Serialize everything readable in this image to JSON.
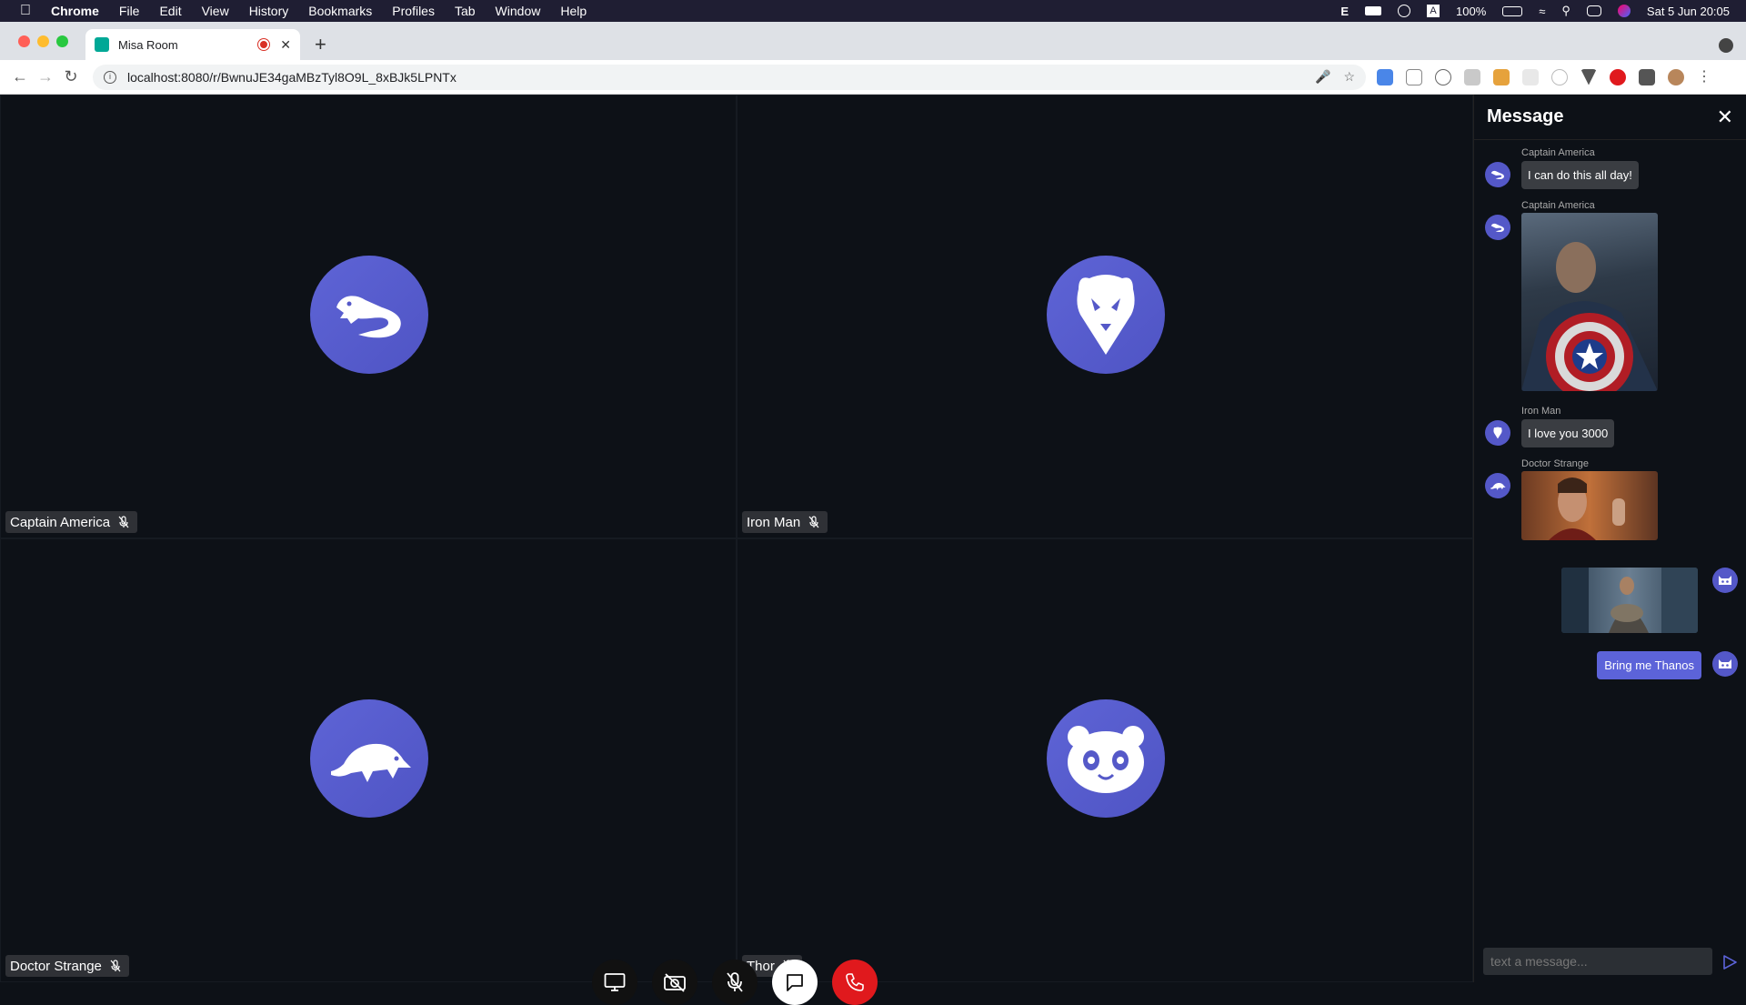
{
  "menubar": {
    "app": "Chrome",
    "items": [
      "File",
      "Edit",
      "View",
      "History",
      "Bookmarks",
      "Profiles",
      "Tab",
      "Window",
      "Help"
    ],
    "battery": "100%",
    "datetime": "Sat 5 Jun  20:05"
  },
  "browser": {
    "tab_title": "Misa Room",
    "url": "localhost:8080/r/BwnuJE34gaMBzTyl8O9L_8xBJk5LPNTx"
  },
  "participants": [
    {
      "name": "Captain America",
      "avatar_icon": "lizard-icon"
    },
    {
      "name": "Iron Man",
      "avatar_icon": "lion-icon"
    },
    {
      "name": "Doctor Strange",
      "avatar_icon": "anteater-icon"
    },
    {
      "name": "Thor",
      "avatar_icon": "panda-icon"
    }
  ],
  "controls": [
    "screen-share-button",
    "camera-off-button",
    "mic-off-button",
    "chat-button",
    "hang-up-button"
  ],
  "chat": {
    "title": "Message",
    "messages": [
      {
        "sender": "Captain America",
        "text": "I can do this all day!"
      },
      {
        "sender": "Captain America",
        "image": "captain-america-photo"
      },
      {
        "sender": "Iron Man",
        "text": "I love you 3000"
      },
      {
        "sender": "Doctor Strange",
        "image": "doctor-strange-photo"
      },
      {
        "sender": "",
        "image": "thor-photo",
        "mine": true
      },
      {
        "sender": "",
        "text": "Bring me Thanos",
        "mine": true
      }
    ],
    "input_placeholder": "text a message..."
  },
  "colors": {
    "accent": "#5c63d9",
    "hangup": "#e0191d",
    "background": "#0d1117"
  }
}
